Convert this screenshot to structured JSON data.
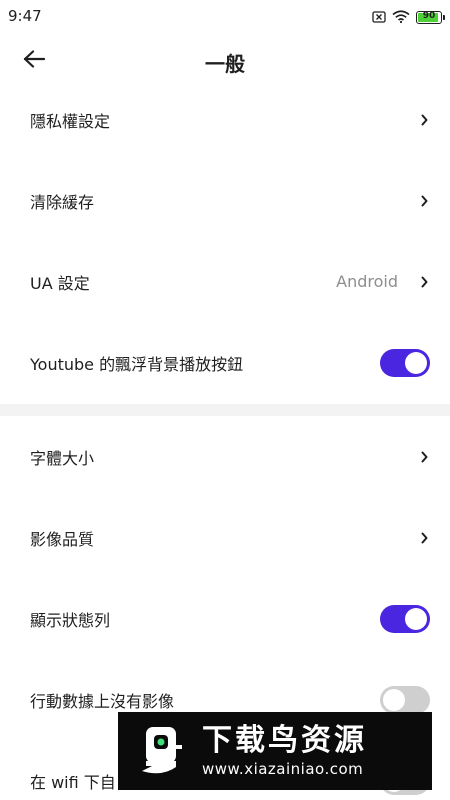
{
  "status_bar": {
    "time": "9:47",
    "battery_level": 90,
    "battery_text": "90",
    "icons": [
      "sim-off-icon",
      "wifi-icon",
      "battery-icon"
    ]
  },
  "header": {
    "back_icon": "arrow-left-icon",
    "title": "一般"
  },
  "settings": [
    {
      "label": "隱私權設定",
      "type": "link"
    },
    {
      "label": "清除緩存",
      "type": "link"
    },
    {
      "label": "UA 設定",
      "type": "link",
      "value": "Android"
    },
    {
      "label": "Youtube 的飄浮背景播放按鈕",
      "type": "toggle",
      "on": true
    },
    {
      "label": "字體大小",
      "type": "link"
    },
    {
      "label": "影像品質",
      "type": "link"
    },
    {
      "label": "顯示狀態列",
      "type": "toggle",
      "on": true
    },
    {
      "label": "行動數據上沒有影像",
      "type": "toggle",
      "on": false
    },
    {
      "label": "在 wifi 下自",
      "type": "toggle",
      "on": false
    }
  ],
  "watermark": {
    "title": "下载鸟资源",
    "url": "www.xiazainiao.com"
  },
  "colors": {
    "accent": "#4a26e0",
    "toggle_off": "#cfcfcf",
    "battery": "#4cd137",
    "secondary_text": "#8e8e8e",
    "section_divider": "#f3f3f3"
  }
}
